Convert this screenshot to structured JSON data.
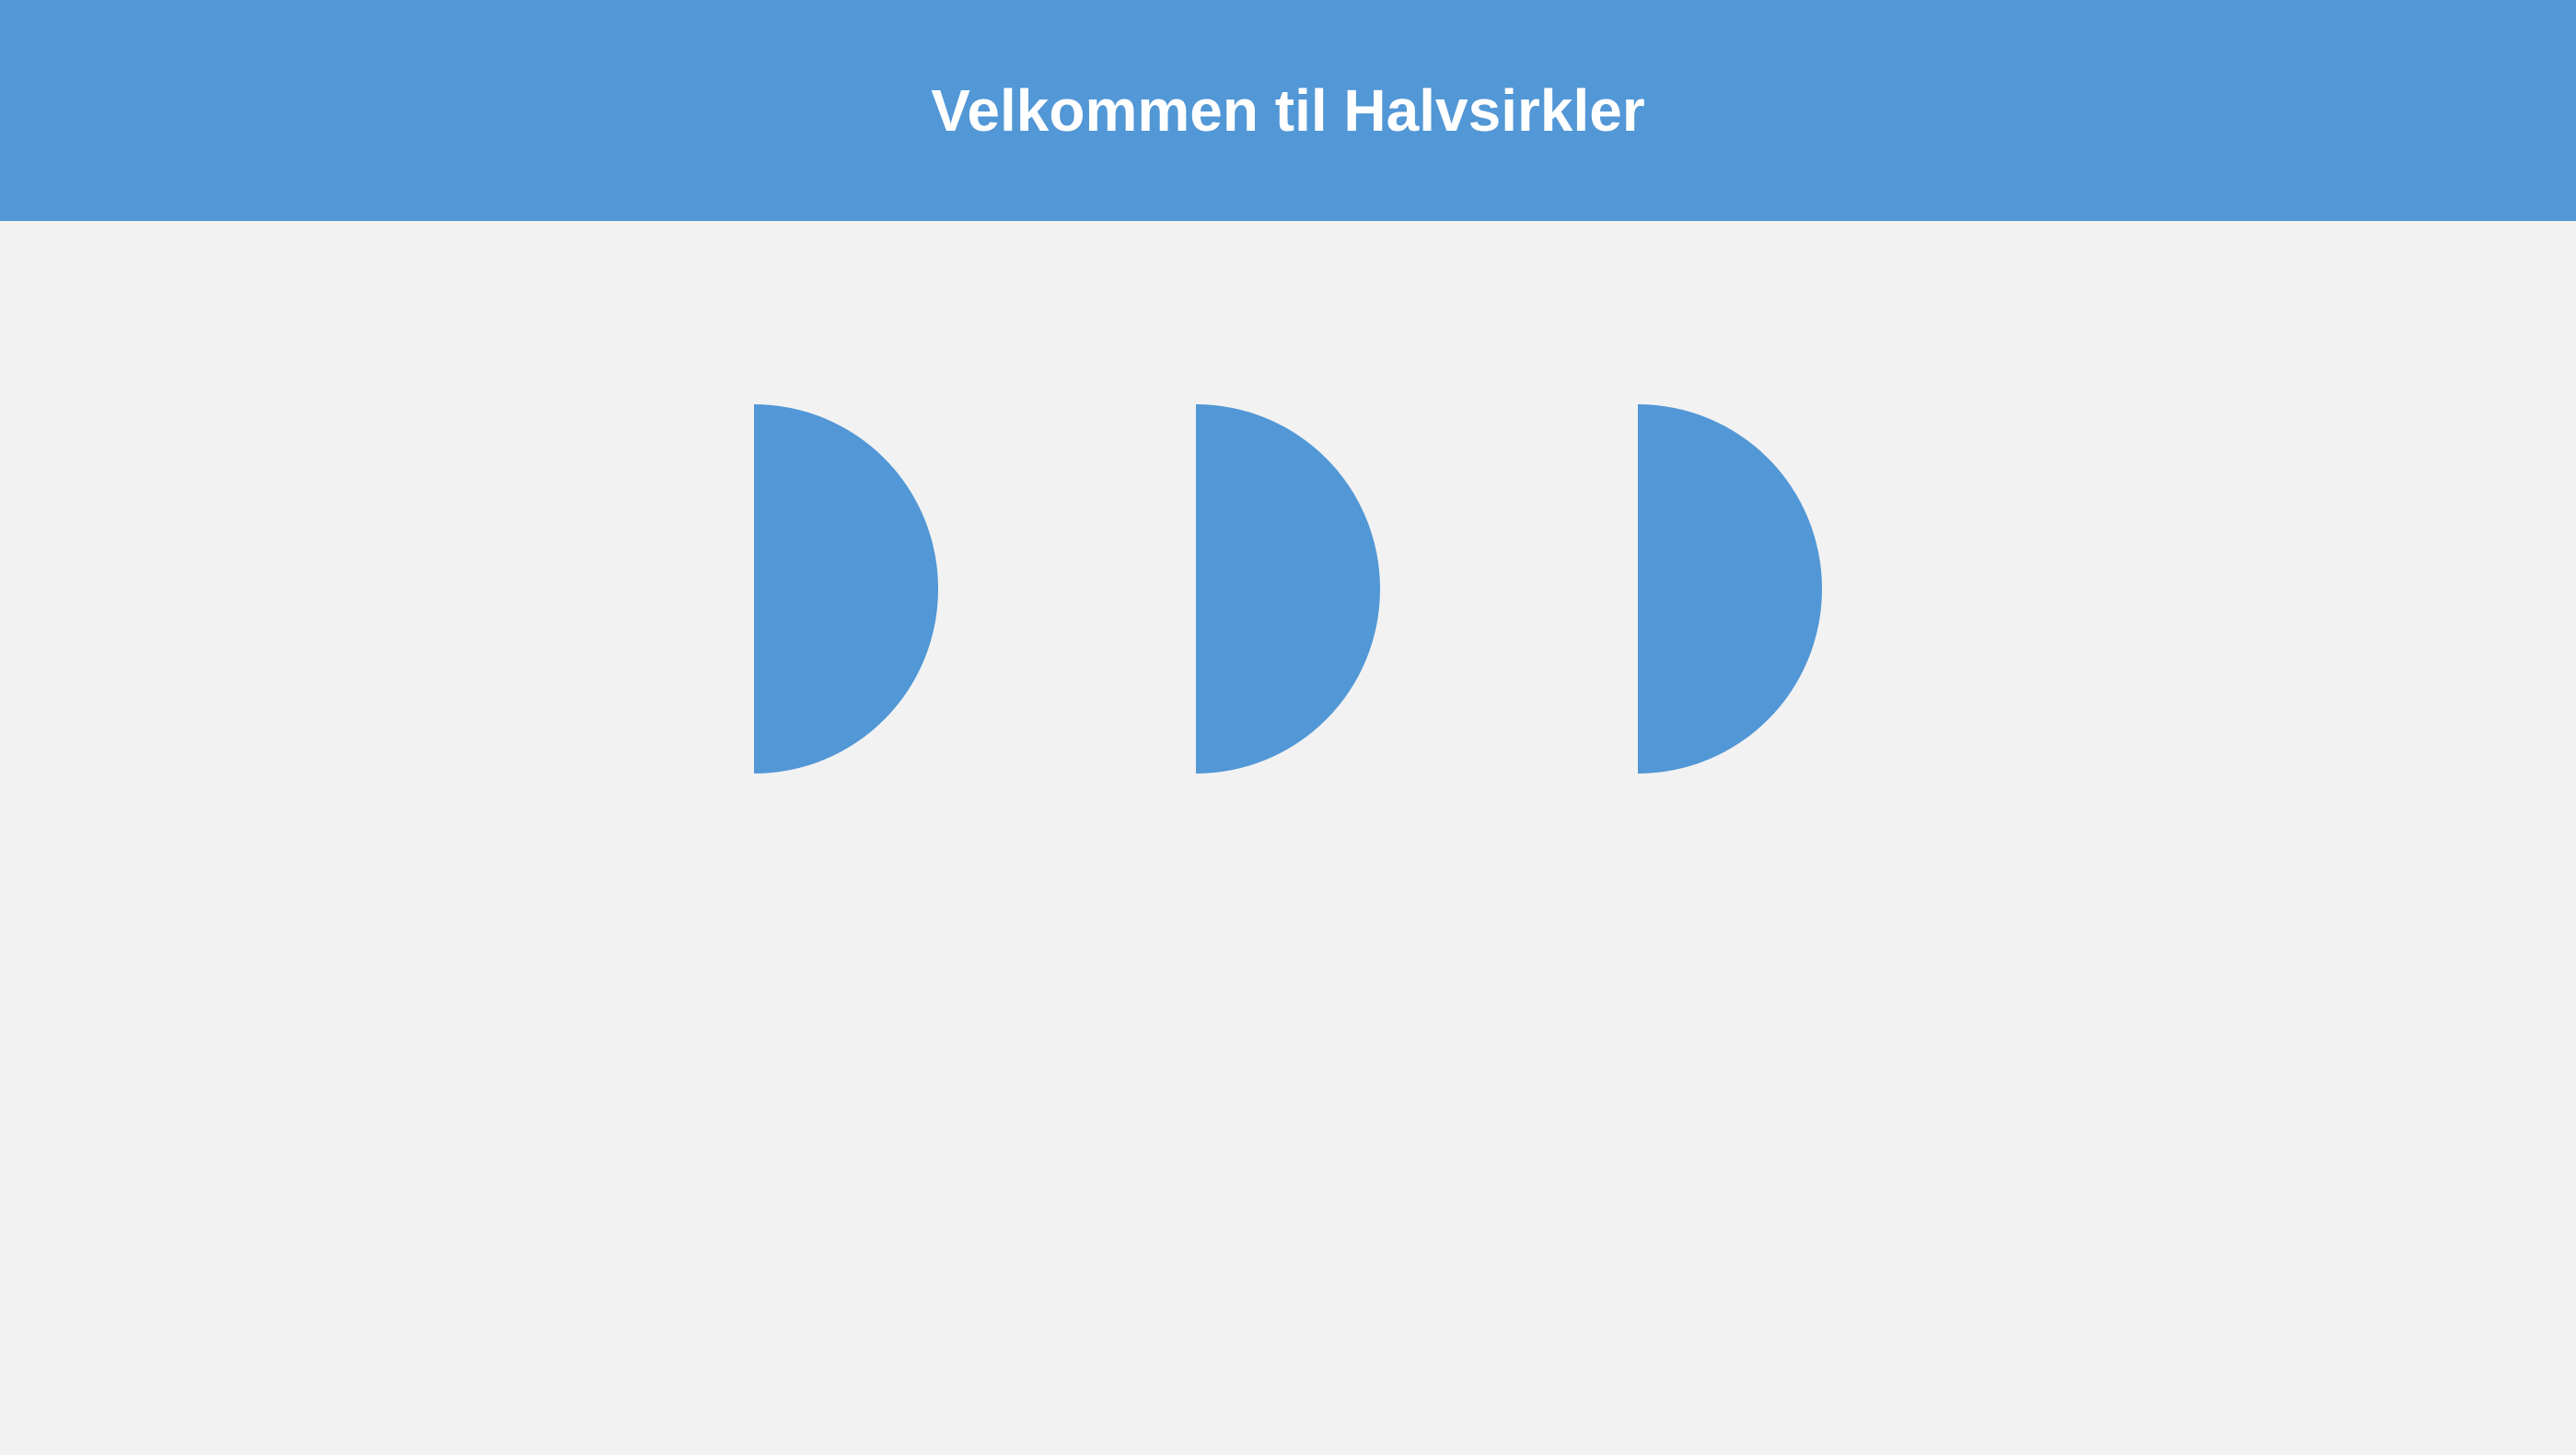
{
  "header": {
    "title": "Velkommen til Halvsirkler"
  },
  "shapes": {
    "half_circles": [
      {
        "name": "half-circle-1"
      },
      {
        "name": "half-circle-2"
      },
      {
        "name": "half-circle-3"
      }
    ]
  },
  "colors": {
    "accent": "#5297d6",
    "background": "#f2f2f2",
    "header_text": "#ffffff"
  }
}
